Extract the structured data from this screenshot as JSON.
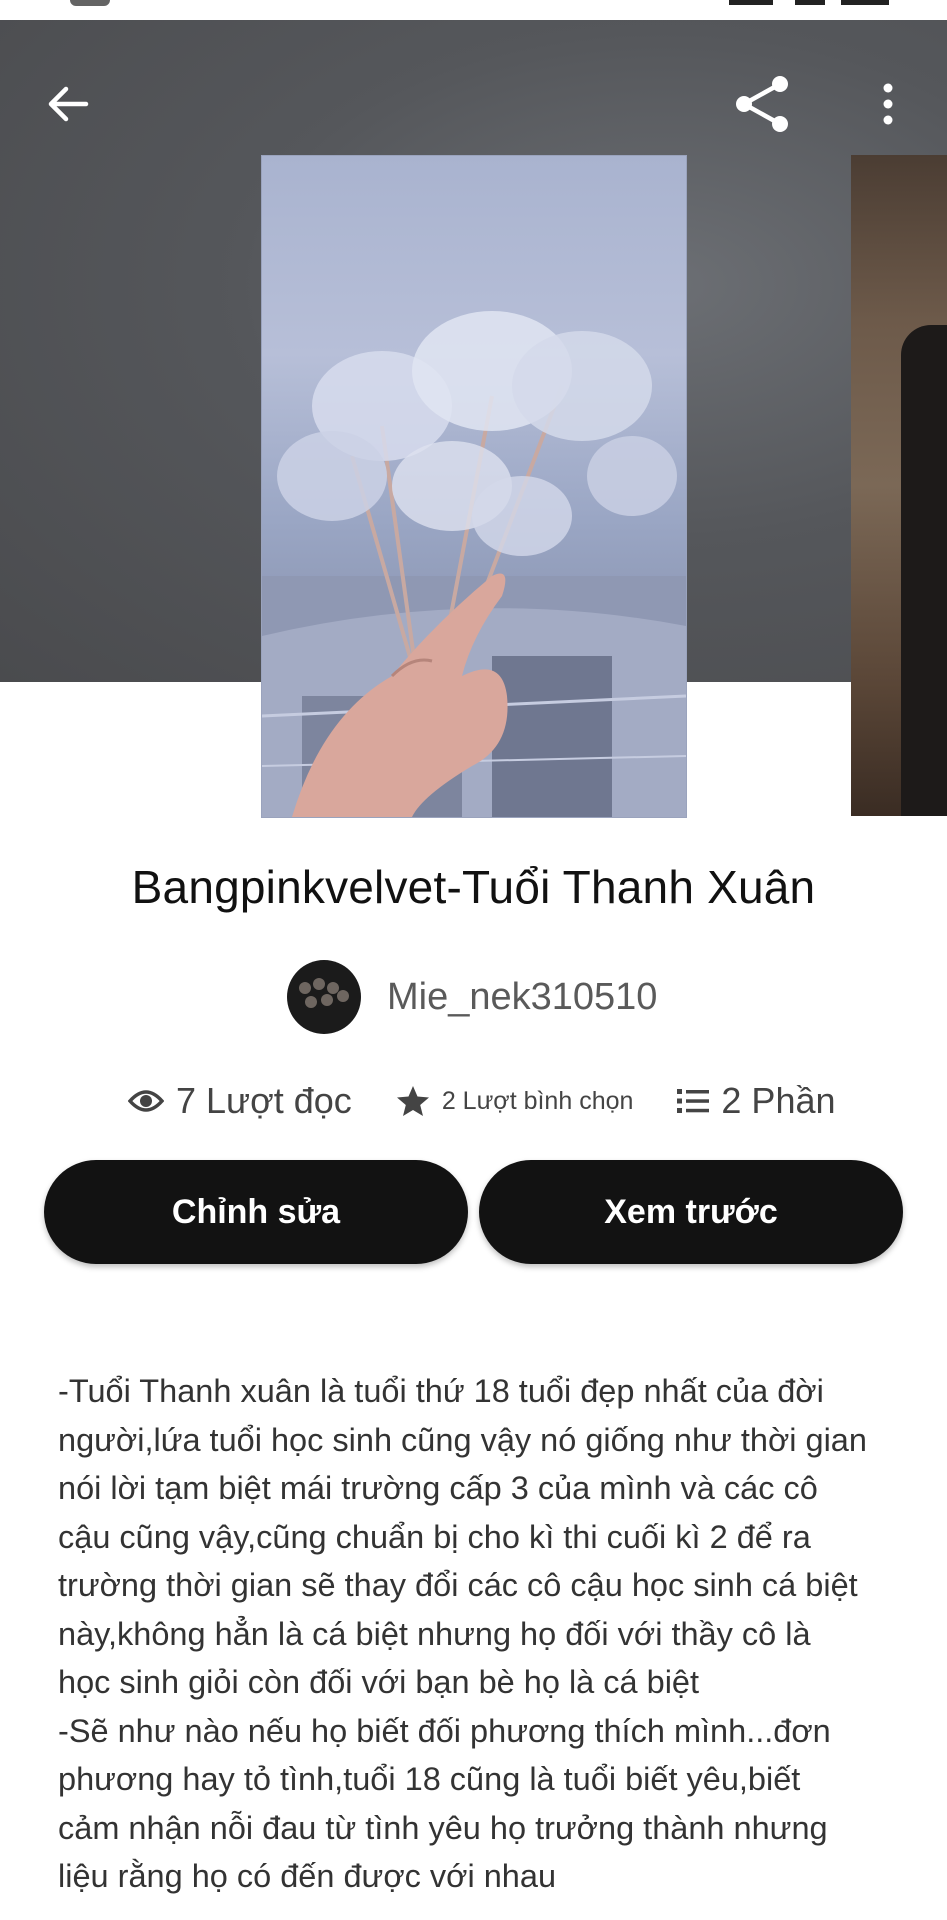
{
  "header": {
    "back_icon": "arrow-left-icon",
    "share_icon": "share-icon",
    "more_icon": "more-vertical-icon"
  },
  "story": {
    "title": "Bangpinkvelvet-Tuổi Thanh Xuân",
    "author": "Mie_nek310510",
    "stats": {
      "reads": "7 Lượt đọc",
      "votes": "2 Lượt bình chọn",
      "parts": "2 Phần"
    },
    "buttons": {
      "edit": "Chỉnh sửa",
      "preview": "Xem trước"
    },
    "description": "-Tuổi Thanh xuân là tuổi thứ 18 tuổi đẹp nhất của đời\nngười,lứa tuổi học sinh cũng vậy nó giống như thời gian\nnói lời tạm biệt mái trường cấp 3 của mình và các cô\ncậu cũng vậy,cũng chuẩn bị cho kì thi cuối kì 2 để ra\ntrường thời gian sẽ thay đổi các cô cậu học sinh cá biệt\nnày,không hẳn là cá biệt nhưng họ đối với thầy cô là\nhọc sinh giỏi còn đối với bạn bè họ là cá biệt\n-Sẽ như nào nếu họ biết đối phương thích mình...đơn\nphương hay tỏ tình,tuổi 18 cũng là tuổi biết yêu,biết\ncảm nhận nỗi đau từ tình yêu họ trưởng thành nhưng\nliệu rằng họ có đến được với nhau"
  },
  "colors": {
    "banner": "#55575b",
    "button_bg": "#121212",
    "button_text": "#ffffff"
  }
}
